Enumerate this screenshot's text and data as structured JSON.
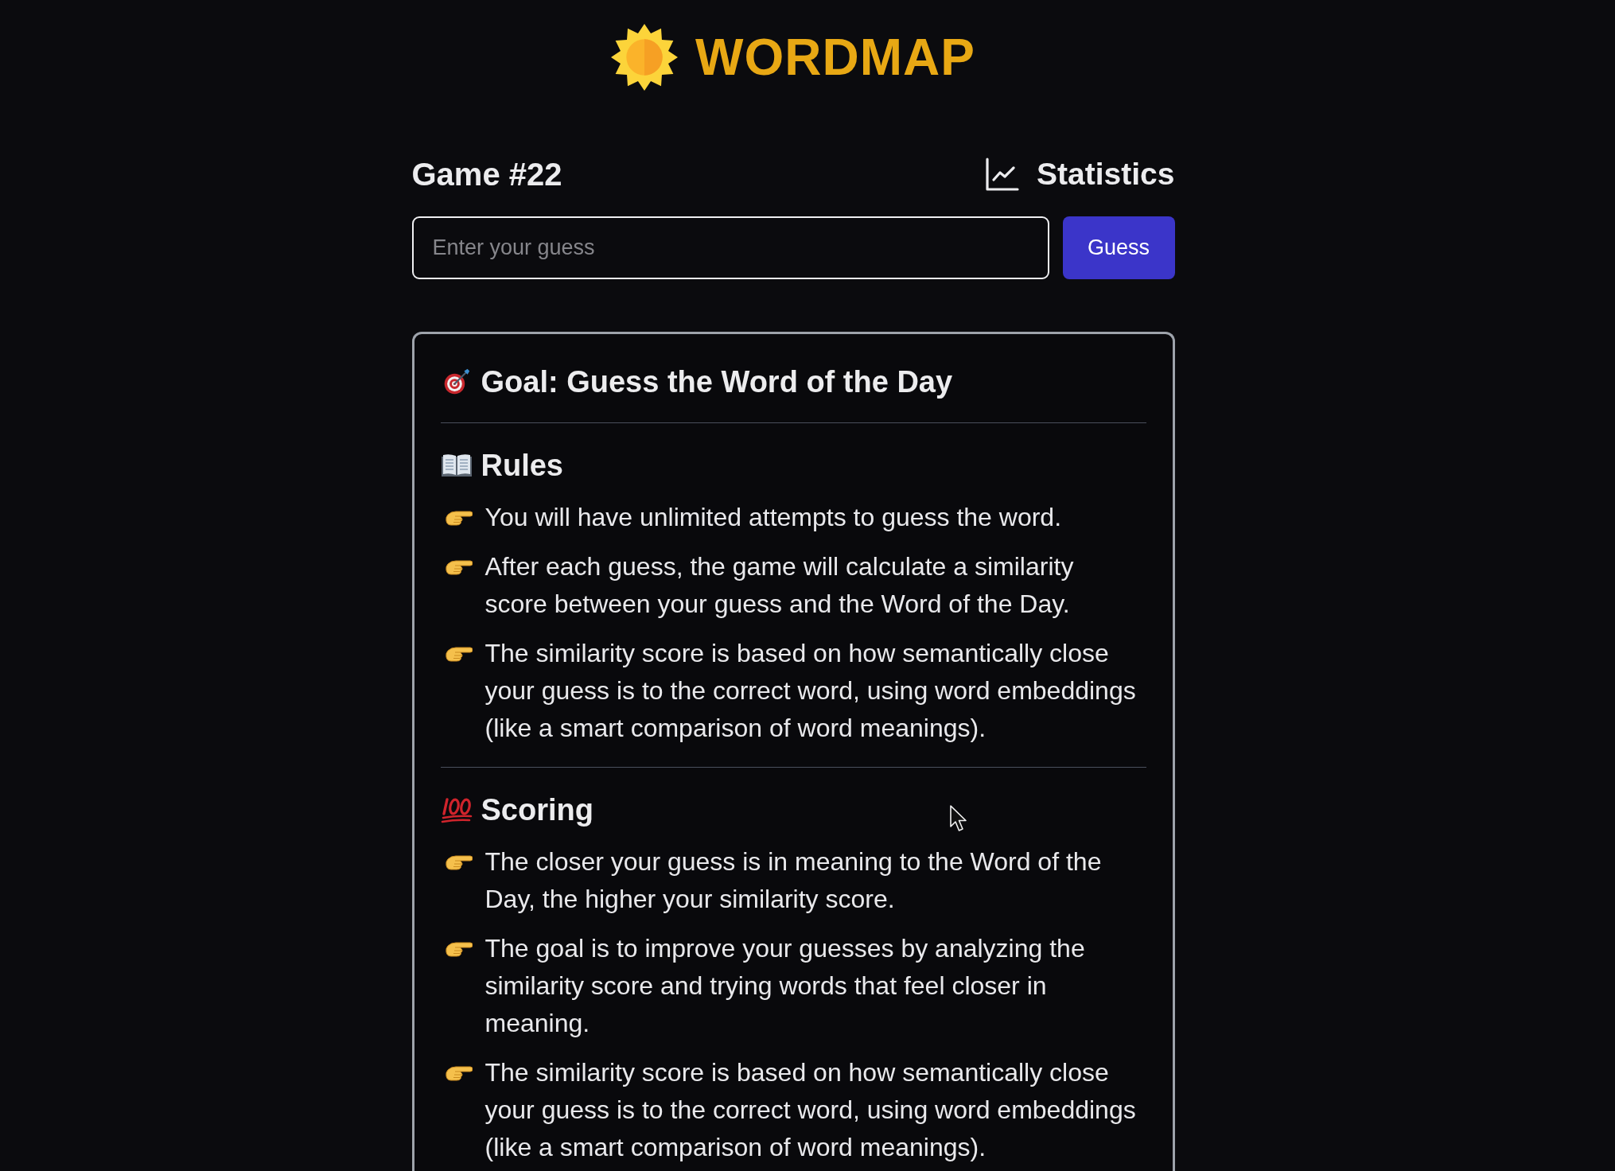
{
  "header": {
    "logo_text": "WORDMAP"
  },
  "game": {
    "title": "Game #22",
    "statistics_label": "Statistics"
  },
  "guess_form": {
    "placeholder": "Enter your guess",
    "button": "Guess"
  },
  "instructions": {
    "goal": "Goal: Guess the Word of the Day",
    "sections": [
      {
        "title": "Rules",
        "items": [
          "You will have unlimited attempts to guess the word.",
          "After each guess, the game will calculate a similarity score between your guess and the Word of the Day.",
          "The similarity score is based on how semantically close your guess is to the correct word, using word embeddings (like a smart comparison of word meanings)."
        ]
      },
      {
        "title": "Scoring",
        "items": [
          "The closer your guess is in meaning to the Word of the Day, the higher your similarity score.",
          "The goal is to improve your guesses by analyzing the similarity score and trying words that feel closer in meaning.",
          "The similarity score is based on how semantically close your guess is to the correct word, using word embeddings (like a smart comparison of word meanings)."
        ]
      }
    ]
  }
}
